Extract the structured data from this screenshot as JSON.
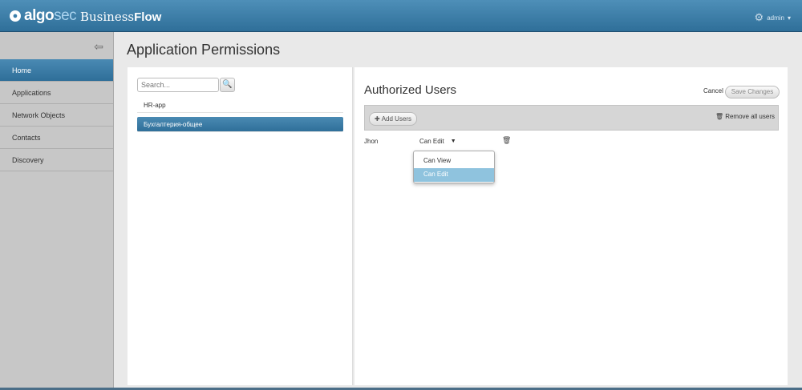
{
  "header": {
    "logo_prefix": "algo",
    "logo_suffix": "sec",
    "product_light": "Business",
    "product_bold": "Flow",
    "user": "admin"
  },
  "sidebar": {
    "items": [
      {
        "label": "Home"
      },
      {
        "label": "Applications"
      },
      {
        "label": "Network Objects"
      },
      {
        "label": "Contacts"
      },
      {
        "label": "Discovery"
      }
    ]
  },
  "page": {
    "title": "Application Permissions"
  },
  "apps": {
    "search_placeholder": "Search...",
    "items": [
      {
        "label": "HR-app"
      },
      {
        "label": "Бухгалтерия-общее"
      }
    ]
  },
  "authorized": {
    "title": "Authorized Users",
    "cancel_label": "Cancel",
    "save_label": "Save Changes",
    "add_users_label": "Add Users",
    "remove_all_label": "Remove all users",
    "users": [
      {
        "name": "Jhon",
        "permission": "Can Edit"
      }
    ],
    "options": [
      "Can View",
      "Can Edit"
    ]
  },
  "colors": {
    "header": "#3b7eaa",
    "active": "#2f6f99",
    "highlight": "#8fc3de"
  }
}
